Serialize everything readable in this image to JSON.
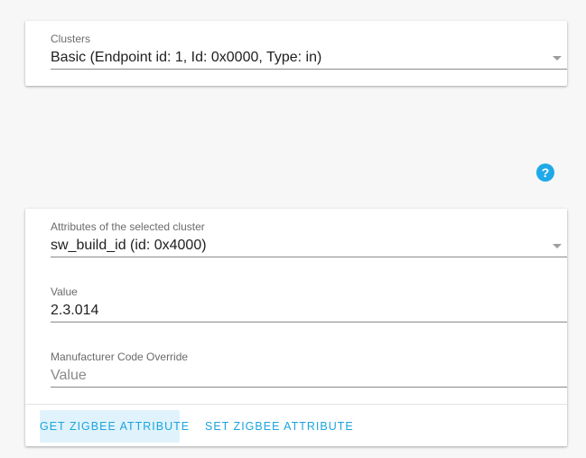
{
  "clusters": {
    "label": "Clusters",
    "selected": "Basic (Endpoint id: 1, Id: 0x0000, Type: in)"
  },
  "help": {
    "icon_glyph": "?",
    "color": "#1fa9e8"
  },
  "attributes": {
    "label": "Attributes of the selected cluster",
    "selected": "sw_build_id (id: 0x4000)"
  },
  "value_field": {
    "label": "Value",
    "value": "2.3.014"
  },
  "manufacturer_field": {
    "label": "Manufacturer Code Override",
    "placeholder": "Value"
  },
  "actions": {
    "get_label": "GET ZIGBEE ATTRIBUTE",
    "set_label": "SET ZIGBEE ATTRIBUTE"
  }
}
